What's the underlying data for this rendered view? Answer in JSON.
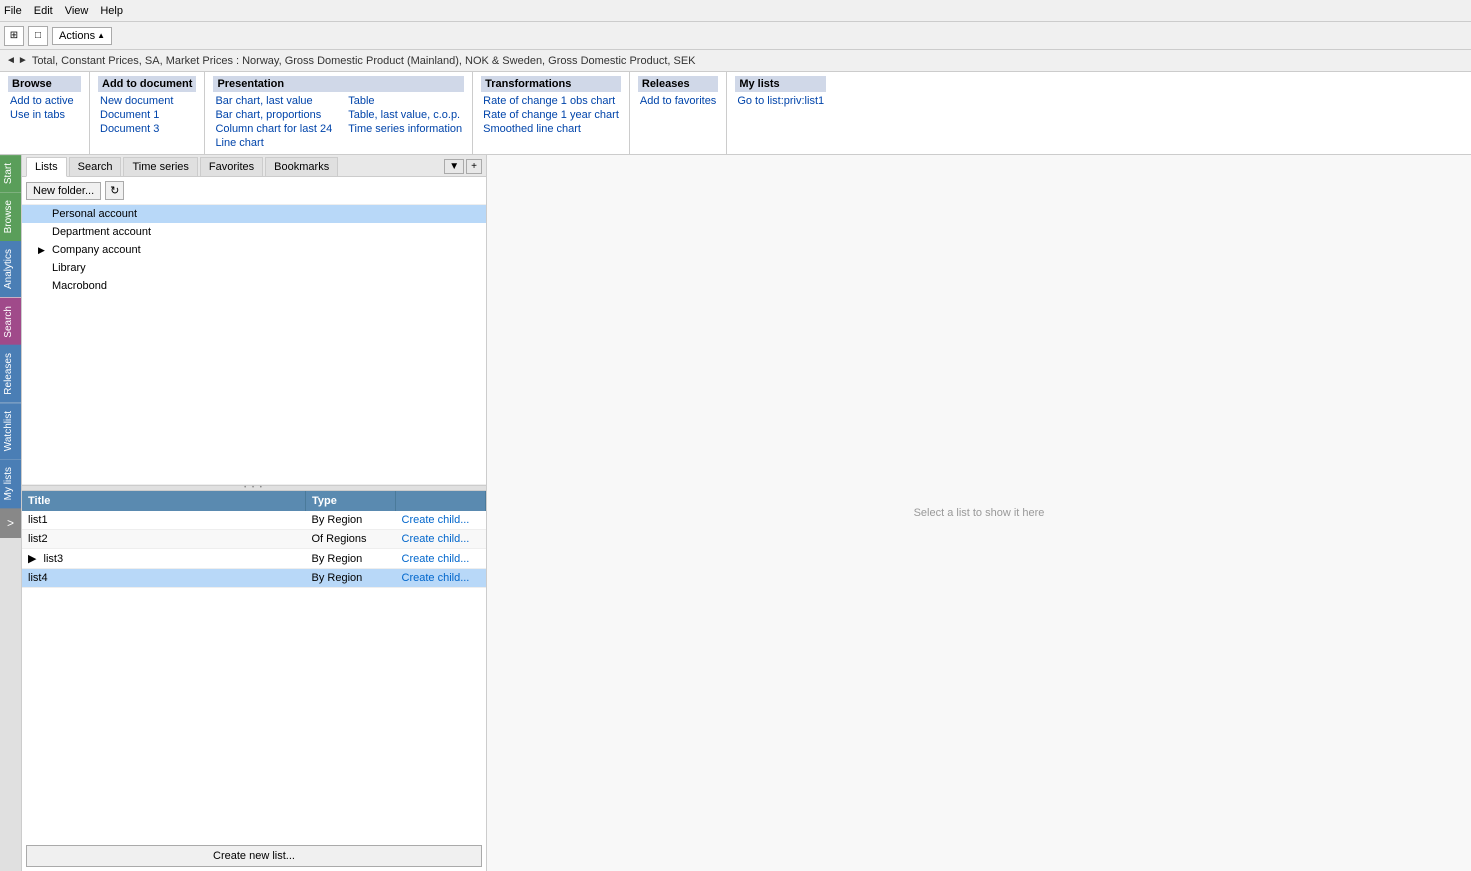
{
  "menubar": {
    "items": [
      "File",
      "Edit",
      "View",
      "Help"
    ]
  },
  "toolbar": {
    "actions_label": "Actions",
    "arrow": "▲"
  },
  "breadcrumb": {
    "text": "Total, Constant Prices, SA, Market Prices : Norway, Gross Domestic Product (Mainland), NOK & Sweden, Gross Domestic Product, SEK"
  },
  "browse_sections": {
    "browse": {
      "title": "Browse",
      "items": [
        "Add to active",
        "Use in tabs"
      ]
    },
    "add_to_doc": {
      "title": "Add to document",
      "items": [
        "New document",
        "Document 1",
        "Document 3"
      ]
    },
    "presentation": {
      "title": "Presentation",
      "items": [
        "Bar chart, last value",
        "Bar chart, proportions",
        "Column chart for last 24",
        "Line chart",
        "Table",
        "Table, last value, c.o.p.",
        "Time series information"
      ]
    },
    "transformations": {
      "title": "Transformations",
      "items": [
        "Rate of change 1 obs chart",
        "Rate of change 1 year chart",
        "Smoothed line chart"
      ]
    },
    "releases": {
      "title": "Releases",
      "items": [
        "Add to favorites"
      ]
    },
    "my_lists": {
      "title": "My lists",
      "items": [
        "Go to list:priv:list1"
      ]
    }
  },
  "panel_tabs": {
    "tabs": [
      "Lists",
      "Search",
      "Time series",
      "Favorites",
      "Bookmarks"
    ],
    "active": "Lists",
    "dropdown_btn": "▼",
    "add_btn": "+"
  },
  "panel_toolbar": {
    "new_folder_label": "New folder...",
    "refresh_icon": "↻"
  },
  "tree": {
    "items": [
      {
        "label": "Personal account",
        "selected": true,
        "has_children": false
      },
      {
        "label": "Department account",
        "selected": false,
        "has_children": false
      },
      {
        "label": "Company account",
        "selected": false,
        "has_children": true
      },
      {
        "label": "Library",
        "selected": false,
        "has_children": false
      },
      {
        "label": "Macrobond",
        "selected": false,
        "has_children": false
      }
    ]
  },
  "table": {
    "columns": [
      "Title",
      "Type",
      ""
    ],
    "rows": [
      {
        "title": "list1",
        "type": "By Region",
        "action": "Create child...",
        "selected": false
      },
      {
        "title": "list2",
        "type": "Of Regions",
        "action": "Create child...",
        "selected": false
      },
      {
        "title": "list3",
        "type": "By Region",
        "action": "Create child...",
        "selected": false,
        "has_children": true
      },
      {
        "title": "list4",
        "type": "By Region",
        "action": "Create child...",
        "selected": true
      }
    ]
  },
  "create_list_btn": "Create new list...",
  "right_panel": {
    "placeholder": "Select a list to show it here"
  },
  "side_tabs": [
    {
      "id": "start",
      "label": "Start",
      "color": "#5a9e5a"
    },
    {
      "id": "browse",
      "label": "Browse",
      "color": "#5a9e5a"
    },
    {
      "id": "analytics",
      "label": "Analytics",
      "color": "#4a7eb5"
    },
    {
      "id": "search",
      "label": "Search",
      "color": "#a04a8a"
    },
    {
      "id": "releases",
      "label": "Releases",
      "color": "#4a7eb5"
    },
    {
      "id": "watchlist",
      "label": "Watchlist",
      "color": "#4a7eb5"
    },
    {
      "id": "mylists",
      "label": "My lists",
      "color": "#4a7eb5"
    },
    {
      "id": "expand",
      "label": ">",
      "color": "#888888"
    }
  ]
}
